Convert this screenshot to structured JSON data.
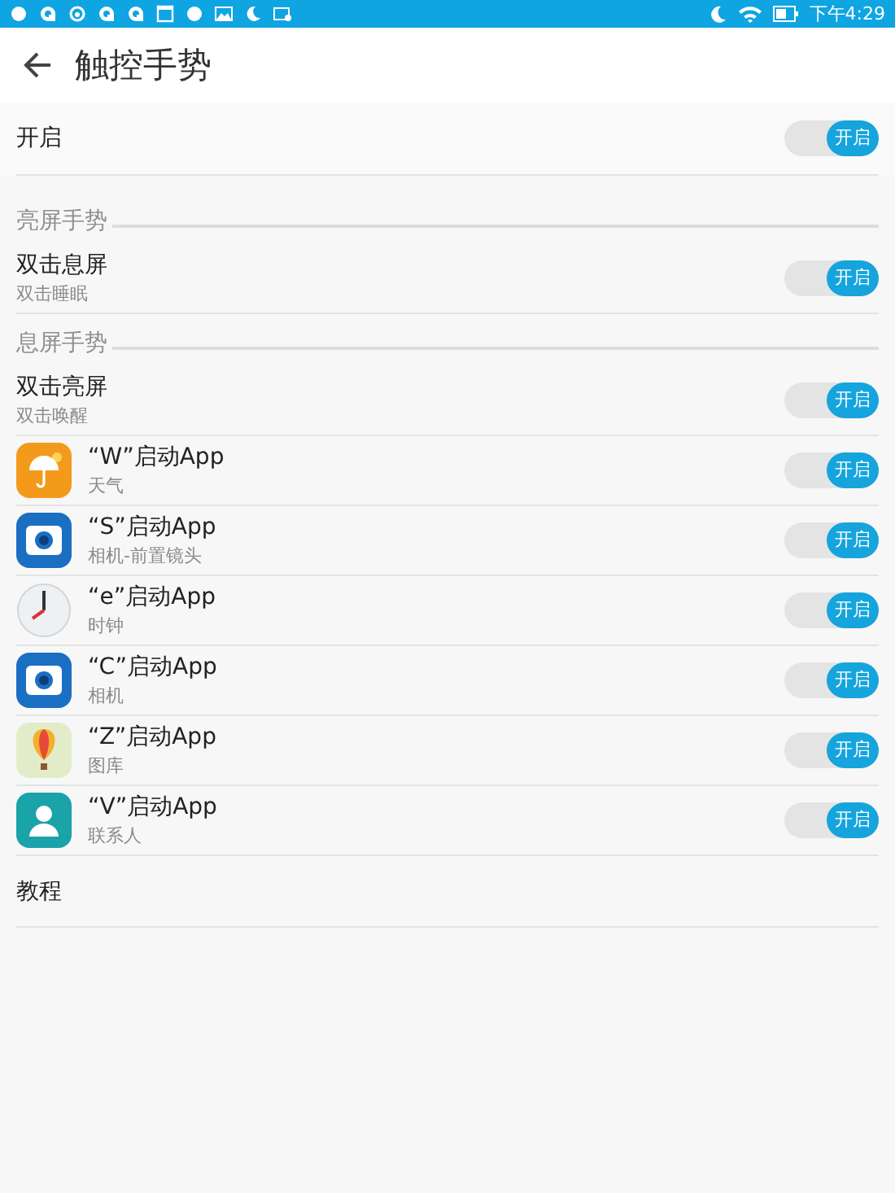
{
  "status_bar": {
    "time": "下午4:29"
  },
  "header": {
    "title": "触控手势"
  },
  "master": {
    "label": "开启",
    "toggle_label": "开启",
    "on": true
  },
  "sections": [
    {
      "title": "亮屏手势",
      "rows": [
        {
          "kind": "plain",
          "title": "双击息屏",
          "subtitle": "双击睡眠",
          "toggle_label": "开启",
          "on": true
        }
      ]
    },
    {
      "title": "息屏手势",
      "rows": [
        {
          "kind": "plain",
          "title": "双击亮屏",
          "subtitle": "双击唤醒",
          "toggle_label": "开启",
          "on": true
        },
        {
          "kind": "app",
          "title": "“W”启动App",
          "subtitle": "天气",
          "toggle_label": "开启",
          "on": true
        },
        {
          "kind": "app",
          "title": "“S”启动App",
          "subtitle": "相机-前置镜头",
          "toggle_label": "开启",
          "on": true
        },
        {
          "kind": "app",
          "title": "“e”启动App",
          "subtitle": "时钟",
          "toggle_label": "开启",
          "on": true
        },
        {
          "kind": "app",
          "title": "“C”启动App",
          "subtitle": "相机",
          "toggle_label": "开启",
          "on": true
        },
        {
          "kind": "app",
          "title": "“Z”启动App",
          "subtitle": "图库",
          "toggle_label": "开启",
          "on": true
        },
        {
          "kind": "app",
          "title": "“V”启动App",
          "subtitle": "联系人",
          "toggle_label": "开启",
          "on": true
        }
      ]
    }
  ],
  "tutorial": {
    "label": "教程"
  }
}
